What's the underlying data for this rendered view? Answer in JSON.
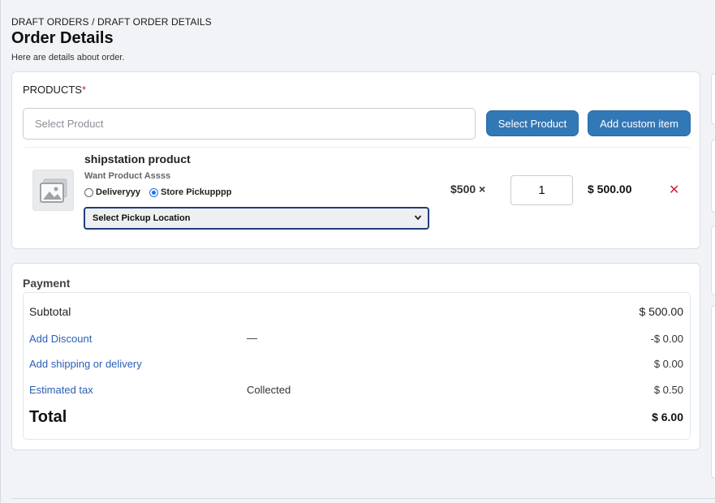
{
  "breadcrumb": "DRAFT ORDERS / DRAFT ORDER DETAILS",
  "title": "Order Details",
  "subtitle": "Here are details about order.",
  "products": {
    "label": "PRODUCTS",
    "required_mark": "*",
    "search_placeholder": "Select Product",
    "select_button": "Select Product",
    "custom_button": "Add custom item",
    "item": {
      "name": "shipstation product",
      "subtitle": "Want Product Assss",
      "delivery_label": "Deliveryyy",
      "pickup_label": "Store Pickupppp",
      "selected_option": "Store Pickupppp",
      "location_select": "Select Pickup Location",
      "unit_price": "$500 ×",
      "quantity": "1",
      "line_total": "$ 500.00",
      "remove_glyph": "✕",
      "thumb_icon": "image-placeholder-icon"
    }
  },
  "payment": {
    "label": "Payment",
    "subtotal_label": "Subtotal",
    "subtotal_value": "$ 500.00",
    "discount_label": "Add Discount",
    "discount_mid": "—",
    "discount_value": "-$ 0.00",
    "shipping_label": "Add shipping or delivery",
    "shipping_value": "$ 0.00",
    "tax_label": "Estimated tax",
    "tax_mid": "Collected",
    "tax_value": "$ 0.50",
    "total_label": "Total",
    "total_value": "$ 6.00"
  },
  "colors": {
    "primary_button": "#3278b7",
    "link": "#2a5fb3",
    "danger": "#d0213a",
    "select_border": "#1f3f7a"
  }
}
